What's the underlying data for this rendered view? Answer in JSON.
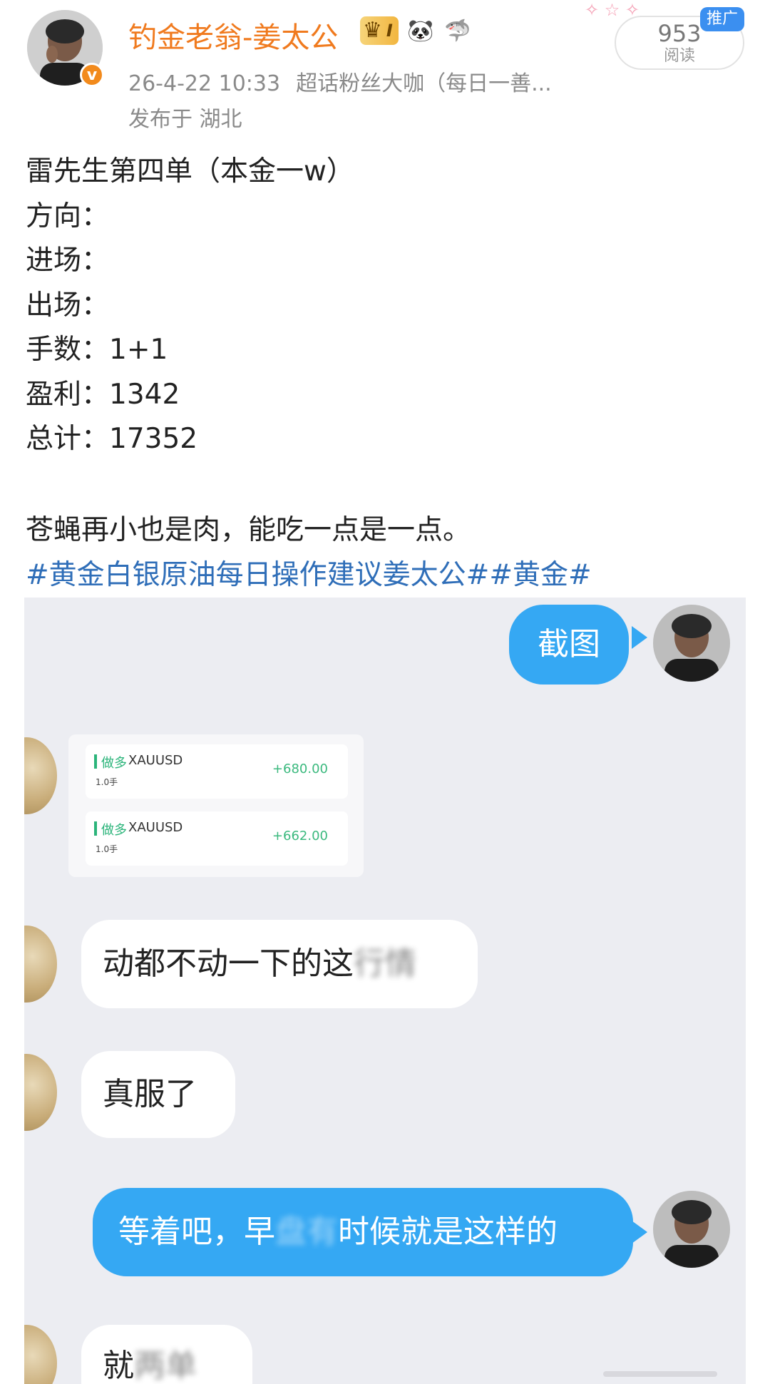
{
  "header": {
    "username": "钓金老翁-姜太公",
    "level_badge": "I",
    "emoji_badges": [
      "🐼",
      "🦈"
    ],
    "avatar_verified_mark": "v",
    "time": "26-4-22 10:33",
    "source": "超话粉丝大咖（每日一善...",
    "location": "发布于 湖北",
    "read_count": "953",
    "read_label": "阅读",
    "ad_tag": "推广"
  },
  "post": {
    "lines": [
      "雷先生第四单（本金一w）",
      "方向：",
      "进场：",
      "出场：",
      "手数：1+1",
      "盈利：1342",
      "总计：17352"
    ],
    "remark": "苍蝇再小也是肉，能吃一点是一点。",
    "hashtags": [
      "#黄金白银原油每日操作建议姜太公#",
      "#黄金#"
    ]
  },
  "chat": {
    "messages": [
      {
        "side": "right",
        "text": "截图"
      },
      {
        "side": "left",
        "text": "动都不动一下的这"
      },
      {
        "side": "left",
        "text": "真服了"
      },
      {
        "side": "right",
        "text": "等着吧，早"
      },
      {
        "side": "left",
        "text": "就"
      }
    ],
    "blurred_fragments": [
      "行情",
      "盘有"
    ],
    "blurred_tail_3": "时候就是这样的",
    "blurred_tail_4": "两单",
    "trades": [
      {
        "type": "做多",
        "symbol": "XAUUSD",
        "lots": "1.0手",
        "profit": "+680.00"
      },
      {
        "type": "做多",
        "symbol": "XAUUSD",
        "lots": "1.0手",
        "profit": "+662.00"
      }
    ]
  },
  "colors": {
    "username": "#f07a1e",
    "hashtag": "#2f6eb8",
    "bubble_right": "#35a8f3",
    "chat_bg": "#ecedf2",
    "profit": "#3bb97e"
  }
}
